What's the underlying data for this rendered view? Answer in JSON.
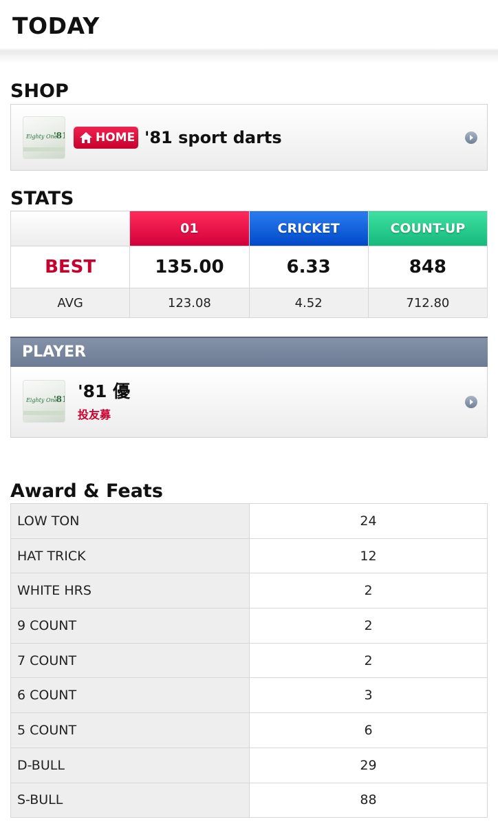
{
  "header": {
    "title": "TODAY"
  },
  "shop": {
    "section_title": "SHOP",
    "badge": "HOME",
    "name": "'81 sport darts"
  },
  "stats": {
    "section_title": "STATS",
    "columns": [
      "01",
      "CRICKET",
      "COUNT-UP"
    ],
    "column_colors": [
      "#e8114a",
      "#1760dc",
      "#2ccf90"
    ],
    "best": {
      "label": "BEST",
      "values": [
        "135.00",
        "6.33",
        "848"
      ]
    },
    "avg": {
      "label": "AVG",
      "values": [
        "123.08",
        "4.52",
        "712.80"
      ]
    }
  },
  "player": {
    "section_title": "PLAYER",
    "name": "'81 優",
    "subtitle": "投友募"
  },
  "awards": {
    "section_title": "Award & Feats",
    "rows": [
      {
        "name": "LOW TON",
        "value": "24"
      },
      {
        "name": "HAT TRICK",
        "value": "12"
      },
      {
        "name": "WHITE HRS",
        "value": "2"
      },
      {
        "name": "9 COUNT",
        "value": "2"
      },
      {
        "name": "7 COUNT",
        "value": "2"
      },
      {
        "name": "6 COUNT",
        "value": "3"
      },
      {
        "name": "5 COUNT",
        "value": "6"
      },
      {
        "name": "D-BULL",
        "value": "29"
      },
      {
        "name": "S-BULL",
        "value": "88"
      }
    ]
  },
  "icons": {
    "home": "home-icon",
    "arrow": "chevron-right-circle-icon",
    "thumbnail": "shop-logo-thumbnail"
  }
}
